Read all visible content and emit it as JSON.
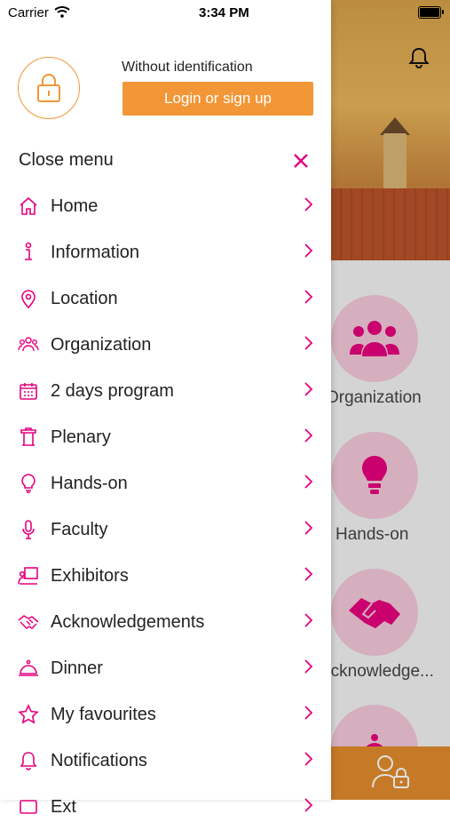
{
  "status_bar": {
    "carrier": "Carrier",
    "time": "3:34 PM"
  },
  "drawer": {
    "identification": "Without identification",
    "login_label": "Login or sign up",
    "close_label": "Close menu",
    "items": [
      {
        "label": "Home",
        "icon": "home-icon"
      },
      {
        "label": "Information",
        "icon": "info-icon"
      },
      {
        "label": "Location",
        "icon": "location-pin-icon"
      },
      {
        "label": "Organization",
        "icon": "people-icon"
      },
      {
        "label": "2 days program",
        "icon": "calendar-icon"
      },
      {
        "label": "Plenary",
        "icon": "lectern-icon"
      },
      {
        "label": "Hands-on",
        "icon": "lightbulb-icon"
      },
      {
        "label": "Faculty",
        "icon": "microphone-icon"
      },
      {
        "label": "Exhibitors",
        "icon": "exhibitor-icon"
      },
      {
        "label": "Acknowledgements",
        "icon": "handshake-icon"
      },
      {
        "label": "Dinner",
        "icon": "cloche-icon"
      },
      {
        "label": "My favourites",
        "icon": "star-icon"
      },
      {
        "label": "Notifications",
        "icon": "bell-icon"
      },
      {
        "label": "Ext",
        "icon": "more-icon"
      }
    ]
  },
  "background": {
    "tiles": [
      {
        "label": "Organization"
      },
      {
        "label": "Hands-on"
      },
      {
        "label": "Acknowledge..."
      }
    ]
  },
  "colors": {
    "accent": "#f29637",
    "pink": "#e5007e",
    "tile_bg": "#f3c8d8",
    "bottom_bar": "#e28b2d"
  }
}
